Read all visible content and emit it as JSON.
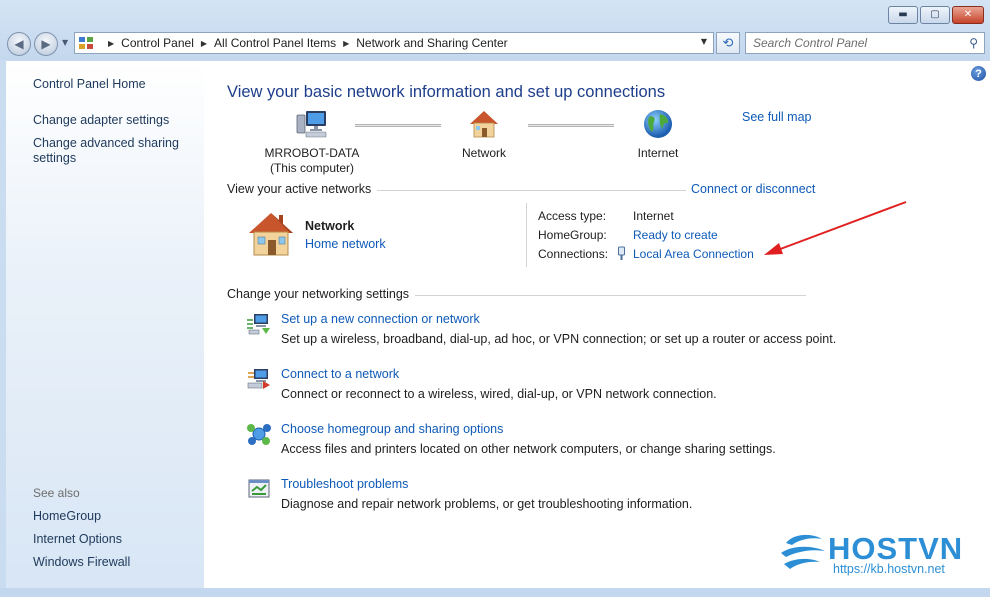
{
  "window": {
    "minimize_glyph": "▬",
    "maximize_glyph": "▢",
    "close_glyph": "✕"
  },
  "address_bar": {
    "crumbs": [
      "Control Panel",
      "All Control Panel Items",
      "Network and Sharing Center"
    ]
  },
  "search": {
    "placeholder": "Search Control Panel"
  },
  "sidebar": {
    "home": "Control Panel Home",
    "links": [
      "Change adapter settings",
      "Change advanced sharing settings"
    ],
    "see_also_label": "See also",
    "see_also": [
      "HomeGroup",
      "Internet Options",
      "Windows Firewall"
    ]
  },
  "main": {
    "title": "View your basic network information and set up connections",
    "see_full_map": "See full map",
    "map": {
      "computer_name": "MRROBOT-DATA",
      "computer_sub": "(This computer)",
      "network": "Network",
      "internet": "Internet"
    },
    "active_networks": {
      "heading": "View your active networks",
      "connect_link": "Connect or disconnect",
      "network_name": "Network",
      "network_type": "Home network",
      "access_type_label": "Access type:",
      "access_type_value": "Internet",
      "homegroup_label": "HomeGroup:",
      "homegroup_value": "Ready to create",
      "connections_label": "Connections:",
      "connections_value": "Local Area Connection"
    },
    "settings": {
      "heading": "Change your networking settings",
      "tasks": [
        {
          "icon": "new-connection-icon",
          "title": "Set up a new connection or network",
          "desc": "Set up a wireless, broadband, dial-up, ad hoc, or VPN connection; or set up a router or access point."
        },
        {
          "icon": "connect-network-icon",
          "title": "Connect to a network",
          "desc": "Connect or reconnect to a wireless, wired, dial-up, or VPN network connection."
        },
        {
          "icon": "homegroup-icon",
          "title": "Choose homegroup and sharing options",
          "desc": "Access files and printers located on other network computers, or change sharing settings."
        },
        {
          "icon": "troubleshoot-icon",
          "title": "Troubleshoot problems",
          "desc": "Diagnose and repair network problems, or get troubleshooting information."
        }
      ]
    }
  },
  "watermark": {
    "brand": "HOSTVN",
    "url": "https://kb.hostvn.net"
  },
  "colors": {
    "link": "#0e5ab8",
    "title": "#1e3e8c",
    "annotation_arrow": "#e02020",
    "watermark": "#2c8fd6"
  }
}
